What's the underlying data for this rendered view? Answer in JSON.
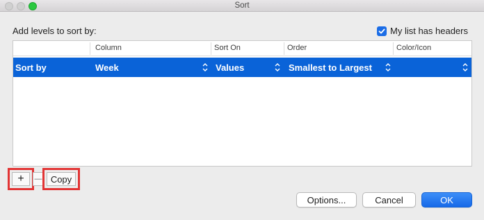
{
  "window": {
    "title": "Sort"
  },
  "prompt": "Add levels to sort by:",
  "headers_checkbox": {
    "label": "My list has headers",
    "checked": true
  },
  "table": {
    "columns": [
      "Column",
      "Sort On",
      "Order",
      "Color/Icon"
    ],
    "rows": [
      {
        "label": "Sort by",
        "column": "Week",
        "sort_on": "Values",
        "order": "Smallest to Largest",
        "color_icon": ""
      }
    ]
  },
  "level_controls": {
    "add": "+",
    "remove": "—",
    "copy": "Copy"
  },
  "buttons": {
    "options": "Options...",
    "cancel": "Cancel",
    "ok": "OK"
  },
  "colors": {
    "accent": "#0a63d8",
    "highlight": "#e23434",
    "zoom": "#2bc840"
  }
}
